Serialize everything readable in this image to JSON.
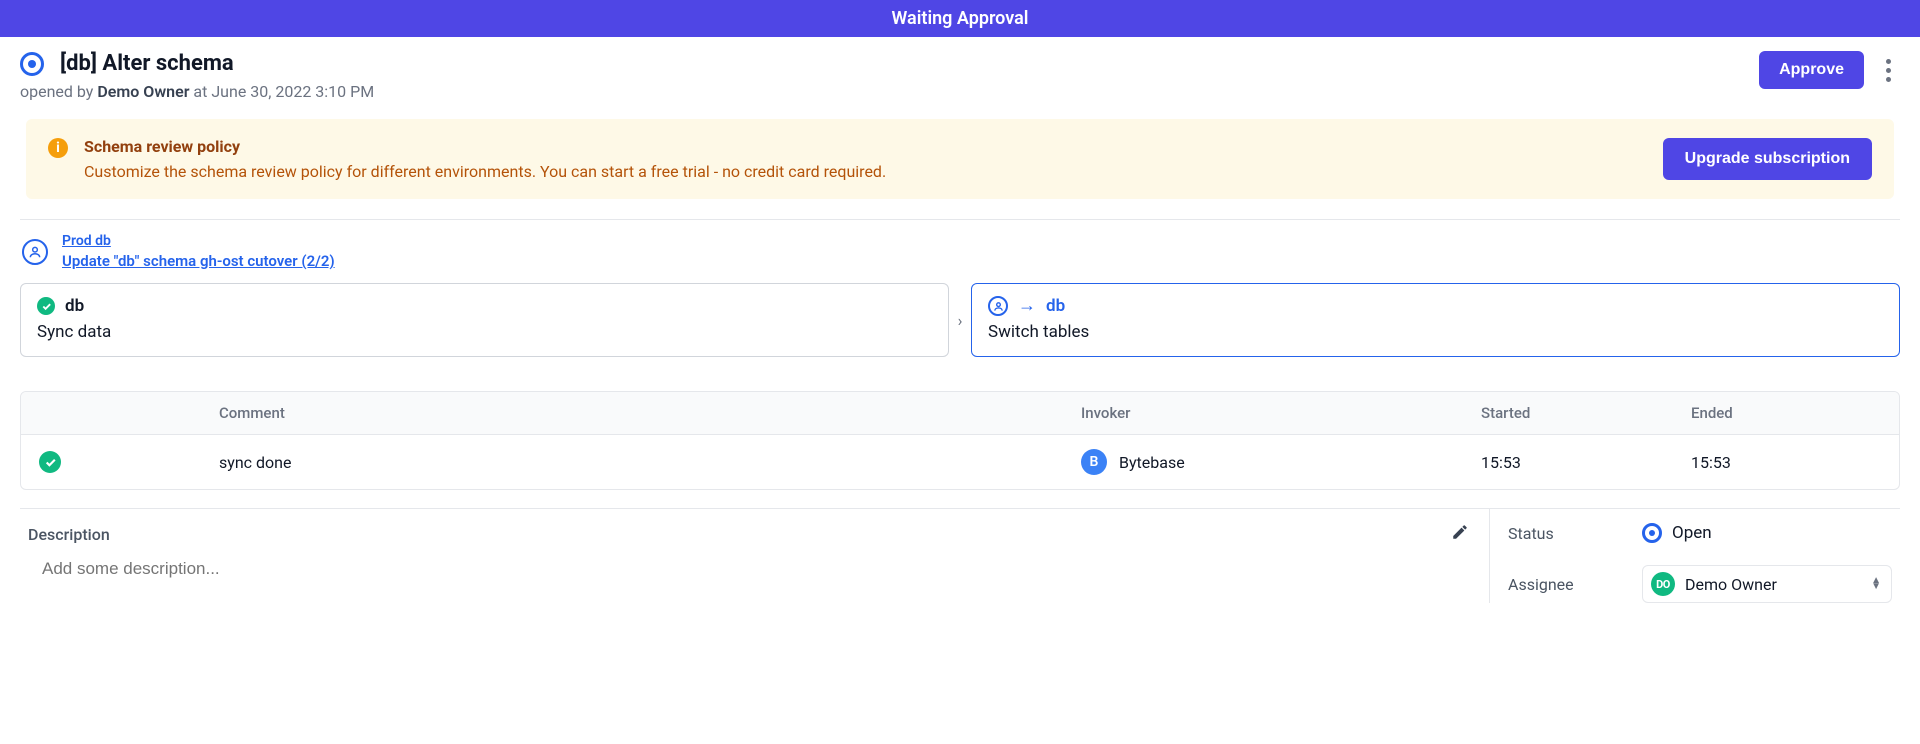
{
  "banner_top": "Waiting Approval",
  "issue": {
    "title": "[db] Alter schema",
    "opened_by_prefix": "opened by ",
    "owner": "Demo Owner",
    "opened_at": " at June 30, 2022 3:10 PM",
    "approve_label": "Approve"
  },
  "promo": {
    "title": "Schema review policy",
    "desc": "Customize the schema review policy for different environments. You can start a free trial - no credit card required.",
    "cta": "Upgrade subscription"
  },
  "stage": {
    "env_link": "Prod db",
    "task_link": "Update \"db\" schema gh-ost cutover (2/2)"
  },
  "steps": [
    {
      "name": "db",
      "sub": "Sync data",
      "status": "done",
      "active": false
    },
    {
      "name": "db",
      "sub": "Switch tables",
      "status": "pending",
      "active": true
    }
  ],
  "table": {
    "headers": {
      "comment": "Comment",
      "invoker": "Invoker",
      "started": "Started",
      "ended": "Ended"
    },
    "rows": [
      {
        "comment": "sync done",
        "invoker_initial": "B",
        "invoker": "Bytebase",
        "started": "15:53",
        "ended": "15:53"
      }
    ]
  },
  "description": {
    "label": "Description",
    "placeholder": "Add some description..."
  },
  "sidebar": {
    "status_label": "Status",
    "status_value": "Open",
    "assignee_label": "Assignee",
    "assignee_initials": "DO",
    "assignee_name": "Demo Owner"
  }
}
